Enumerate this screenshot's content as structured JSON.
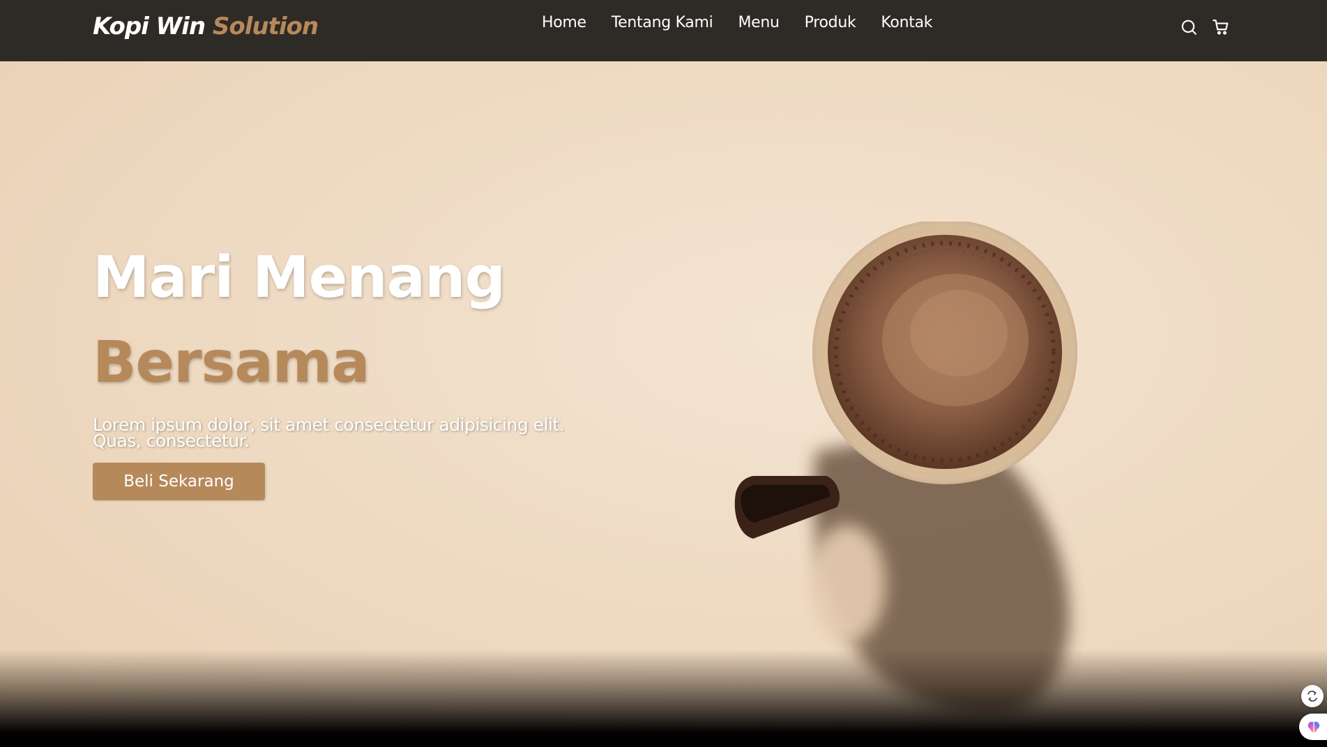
{
  "brand": {
    "part1": "Kopi Win",
    "part2": "Solution"
  },
  "nav": {
    "items": [
      {
        "label": "Home"
      },
      {
        "label": "Tentang Kami"
      },
      {
        "label": "Menu"
      },
      {
        "label": "Produk"
      },
      {
        "label": "Kontak"
      }
    ],
    "icons": [
      "search-icon",
      "shopping-cart-icon"
    ]
  },
  "hero": {
    "title_line1": "Mari Menang",
    "title_line2": "Bersama",
    "description": "Lorem ipsum dolor, sit amet consectetur adipisicing elit. Quas, consectetur.",
    "cta_label": "Beli Sekarang"
  },
  "floating": {
    "icons": [
      "translate-icon",
      "brain-icon"
    ]
  },
  "colors": {
    "navbar_bg": "#2e2a26",
    "accent": "#b6895b",
    "hero_bg": "#f0dfca",
    "text_light": "#ffffff"
  }
}
